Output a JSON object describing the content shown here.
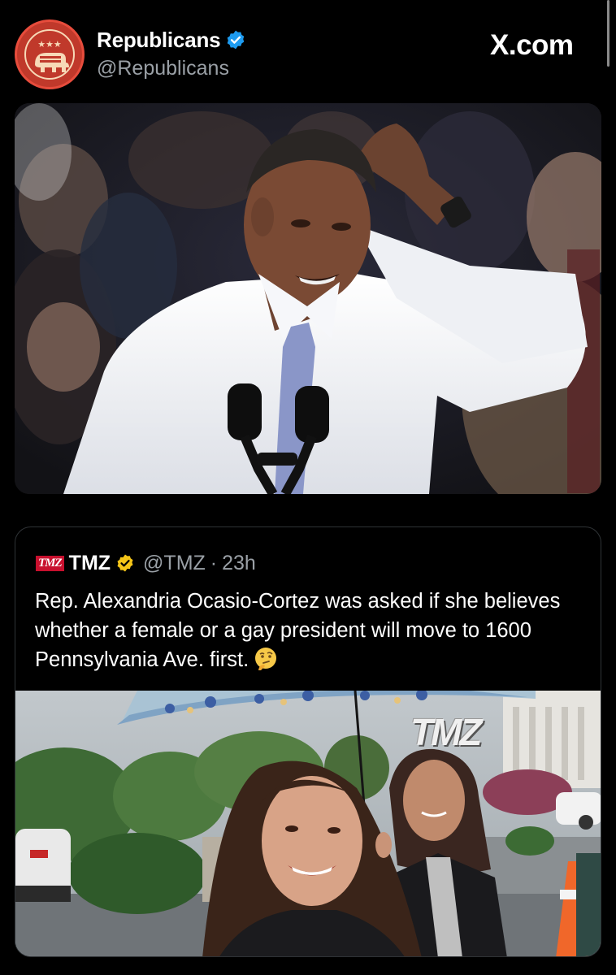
{
  "header": {
    "name": "Republicans",
    "handle": "@Republicans",
    "brand": "X.com",
    "verified_color": "#1d9bf0"
  },
  "quoted_tweet": {
    "logo_text": "TMZ",
    "name": "TMZ",
    "handle": "@TMZ",
    "separator": "·",
    "time": "23h",
    "text": "Rep. Alexandria Ocasio-Cortez was asked if she believes whether a female or a gay president will move to 1600 Pennsylvania Ave. first.",
    "emoji": "thinking-face-emoji",
    "verified_color": "#f5c518",
    "watermark": "TMZ"
  },
  "icons": {
    "verified": "verified-badge-icon",
    "gold_verified": "gold-verified-badge-icon"
  }
}
